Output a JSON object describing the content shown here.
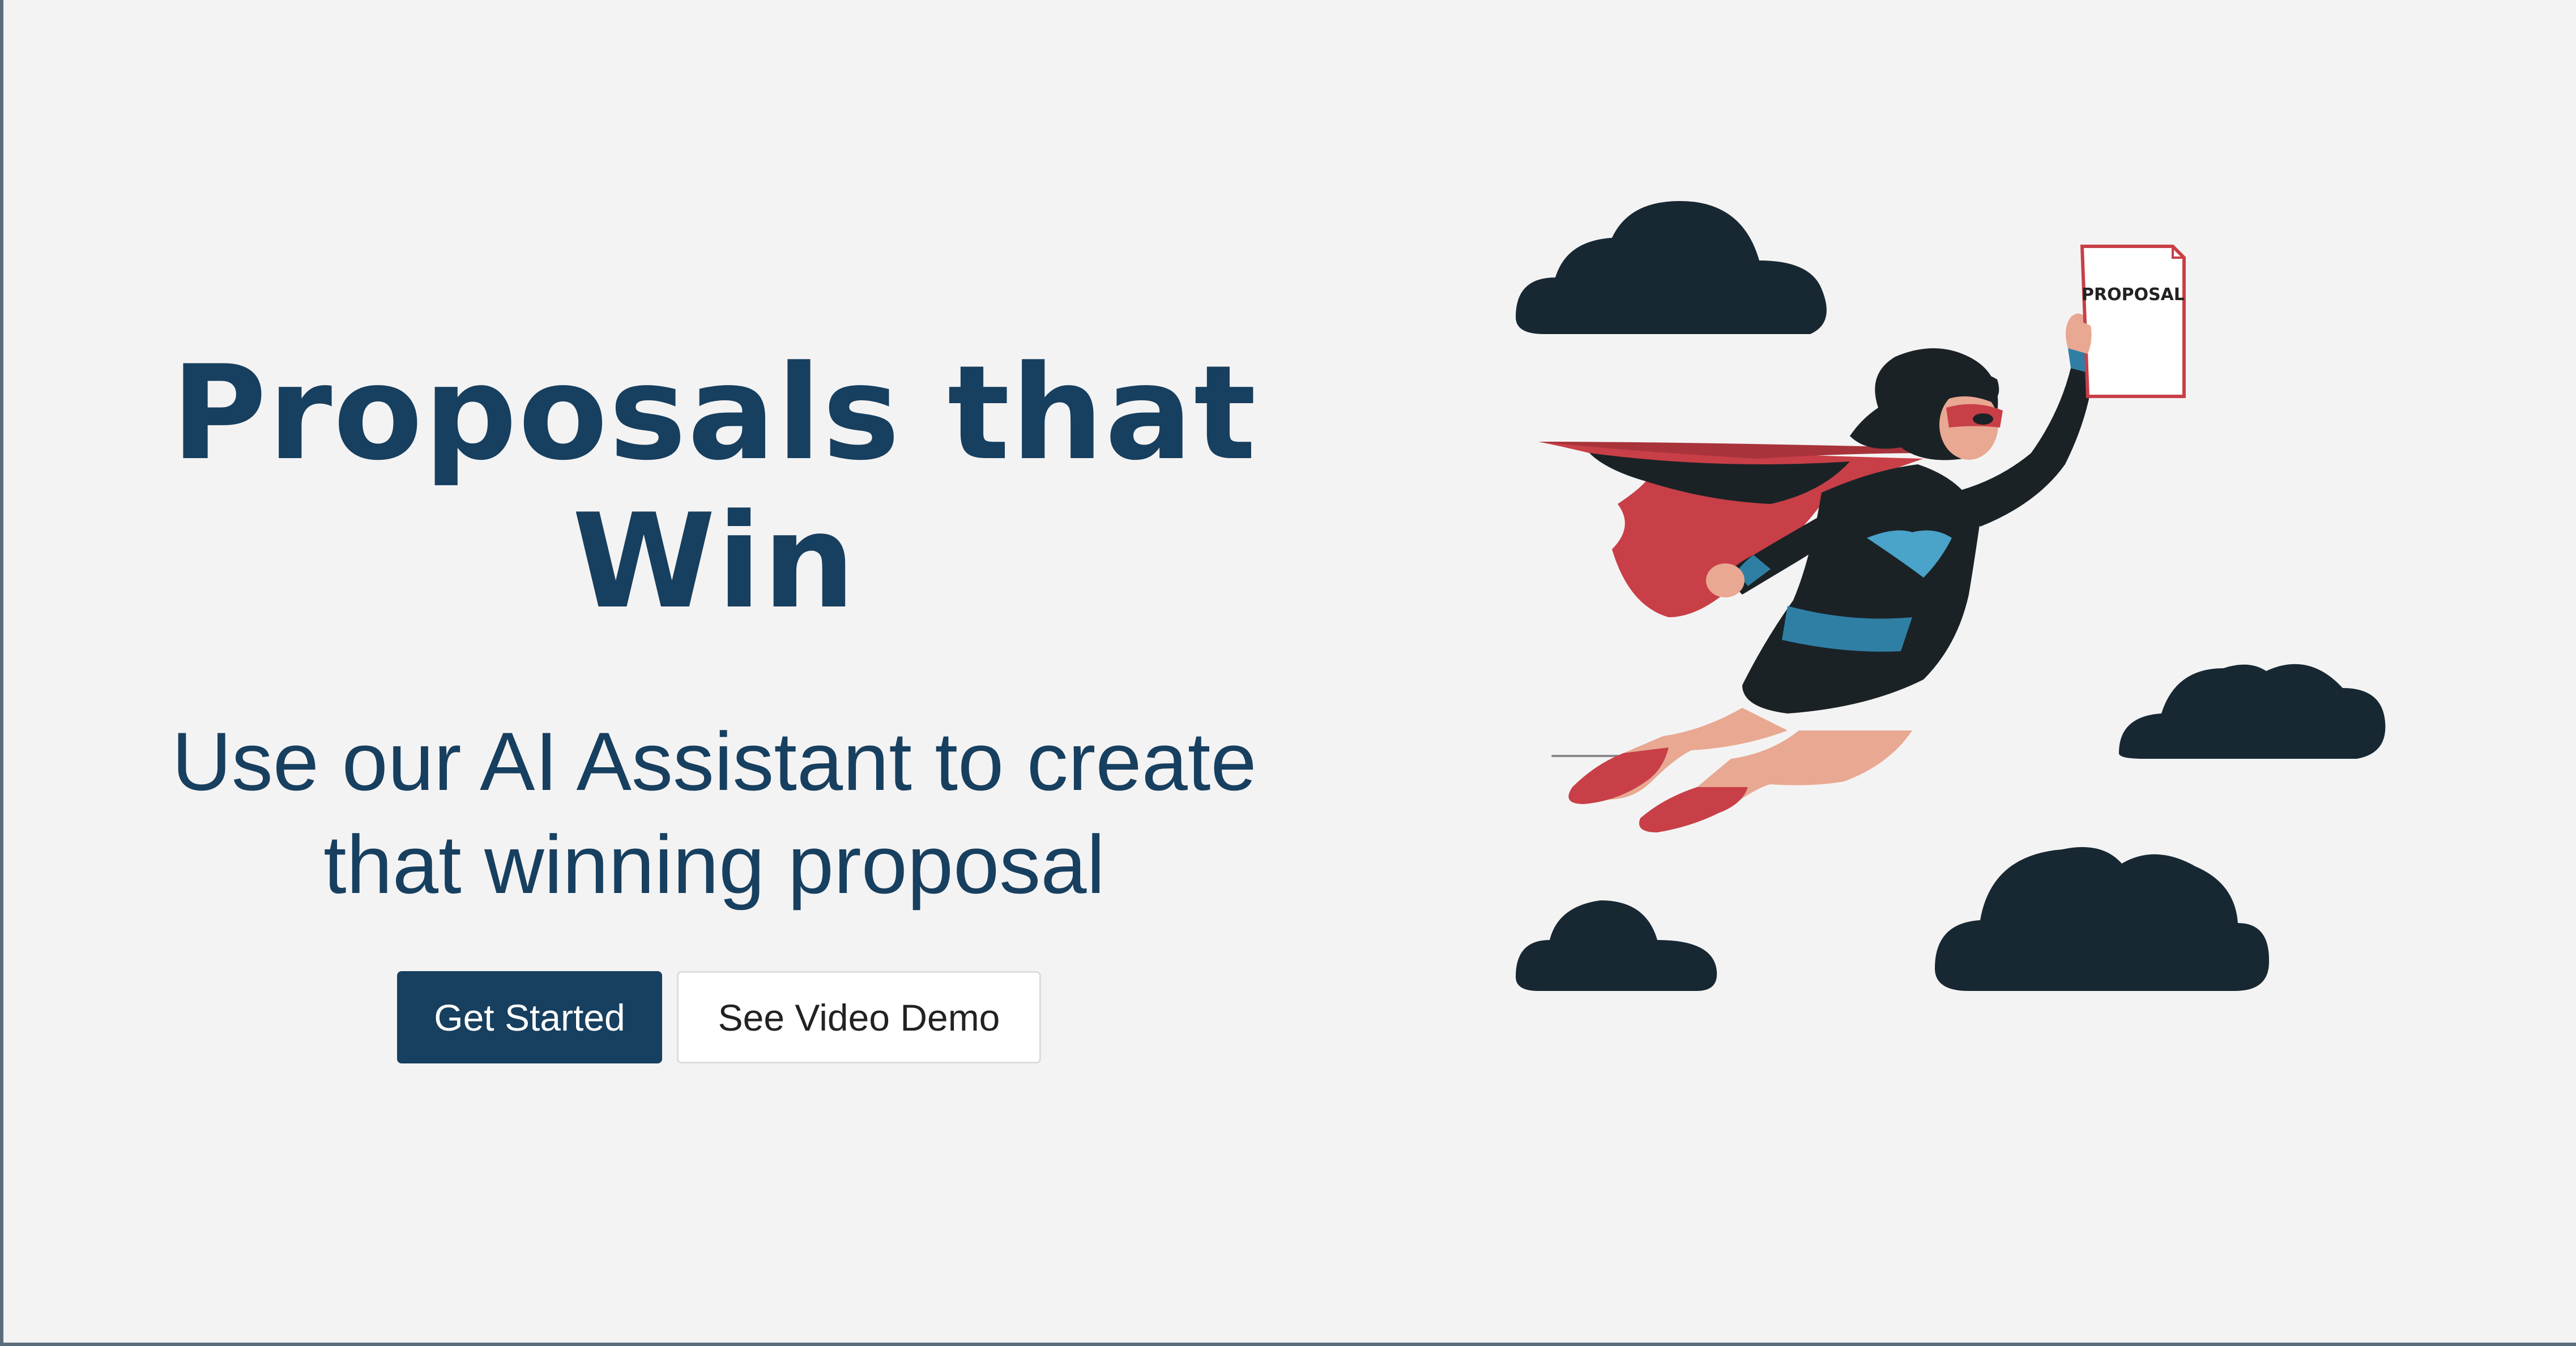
{
  "hero": {
    "headline_line1": "Proposals that",
    "headline_line2": "Win",
    "subhead_line1": "Use our AI Assistant to create",
    "subhead_line2": "that winning proposal"
  },
  "cta": {
    "primary_label": "Get Started",
    "secondary_label": "See Video Demo"
  },
  "illustration": {
    "document_label": "PROPOSAL"
  },
  "colors": {
    "brand_navy": "#173f5f",
    "cloud": "#172833",
    "cape_red": "#c83f47",
    "accent_teal": "#2f7fa5",
    "background": "#f4f3f3"
  }
}
